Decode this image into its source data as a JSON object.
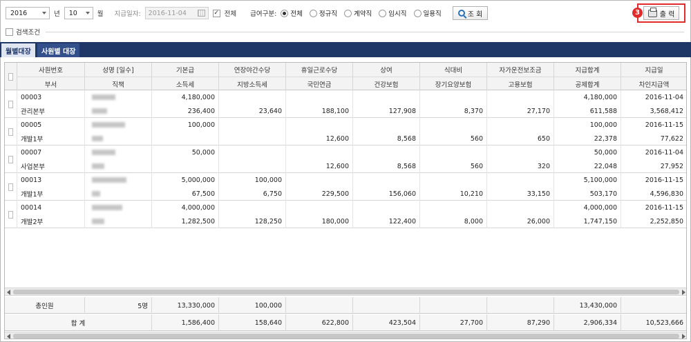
{
  "toolbar": {
    "year": "2016",
    "year_unit": "년",
    "month": "10",
    "month_unit": "월",
    "pay_date_label": "지급일자:",
    "pay_date_value": "2016-11-04",
    "all_label": "전체",
    "pay_type_label": "급여구분:",
    "pay_types": [
      "전체",
      "정규직",
      "계약직",
      "임시직",
      "일용직"
    ],
    "search_label": "조 회",
    "print_label": "출 력",
    "callout_number": "3"
  },
  "search_condition_label": "검색조건",
  "tabs": [
    "월별대장",
    "사원별 대장"
  ],
  "header_row1": [
    "사원번호",
    "성명 [일수]",
    "기본급",
    "연장야간수당",
    "휴일근로수당",
    "상여",
    "식대비",
    "자가운전보조금",
    "지급합계",
    "지급일"
  ],
  "header_row2": [
    "부서",
    "직책",
    "소득세",
    "지방소득세",
    "국민연금",
    "건강보험",
    "장기요양보험",
    "고용보험",
    "공제합계",
    "차인지급액"
  ],
  "rows": [
    {
      "line1": [
        "00003",
        "",
        "4,180,000",
        "",
        "",
        "",
        "",
        "",
        "4,180,000",
        "2016-11-04"
      ],
      "line2": [
        "관리본부",
        "",
        "236,400",
        "23,640",
        "188,100",
        "127,908",
        "8,370",
        "27,170",
        "611,588",
        "3,568,412"
      ]
    },
    {
      "line1": [
        "00005",
        "",
        "100,000",
        "",
        "",
        "",
        "",
        "",
        "100,000",
        "2016-11-15"
      ],
      "line2": [
        "개발1부",
        "",
        "",
        "",
        "12,600",
        "8,568",
        "560",
        "650",
        "22,378",
        "77,622"
      ]
    },
    {
      "line1": [
        "00007",
        "",
        "50,000",
        "",
        "",
        "",
        "",
        "",
        "50,000",
        "2016-11-04"
      ],
      "line2": [
        "사업본부",
        "",
        "",
        "",
        "12,600",
        "8,568",
        "560",
        "320",
        "22,048",
        "27,952"
      ]
    },
    {
      "line1": [
        "00013",
        "",
        "5,000,000",
        "100,000",
        "",
        "",
        "",
        "",
        "5,100,000",
        "2016-11-15"
      ],
      "line2": [
        "개발1부",
        "",
        "67,500",
        "6,750",
        "229,500",
        "156,060",
        "10,210",
        "33,150",
        "503,170",
        "4,596,830"
      ]
    },
    {
      "line1": [
        "00014",
        "",
        "4,000,000",
        "",
        "",
        "",
        "",
        "",
        "4,000,000",
        "2016-11-15"
      ],
      "line2": [
        "개발2부",
        "",
        "1,282,500",
        "128,250",
        "180,000",
        "122,400",
        "8,000",
        "26,000",
        "1,747,150",
        "2,252,850"
      ]
    }
  ],
  "footer": {
    "headcount_label": "총인원",
    "headcount_value": "5명",
    "row1": [
      "13,330,000",
      "100,000",
      "",
      "",
      "",
      "",
      "13,430,000",
      ""
    ],
    "total_label": "합 계",
    "row2": [
      "1,586,400",
      "158,640",
      "622,800",
      "423,504",
      "27,700",
      "87,290",
      "2,906,334",
      "10,523,666"
    ]
  }
}
